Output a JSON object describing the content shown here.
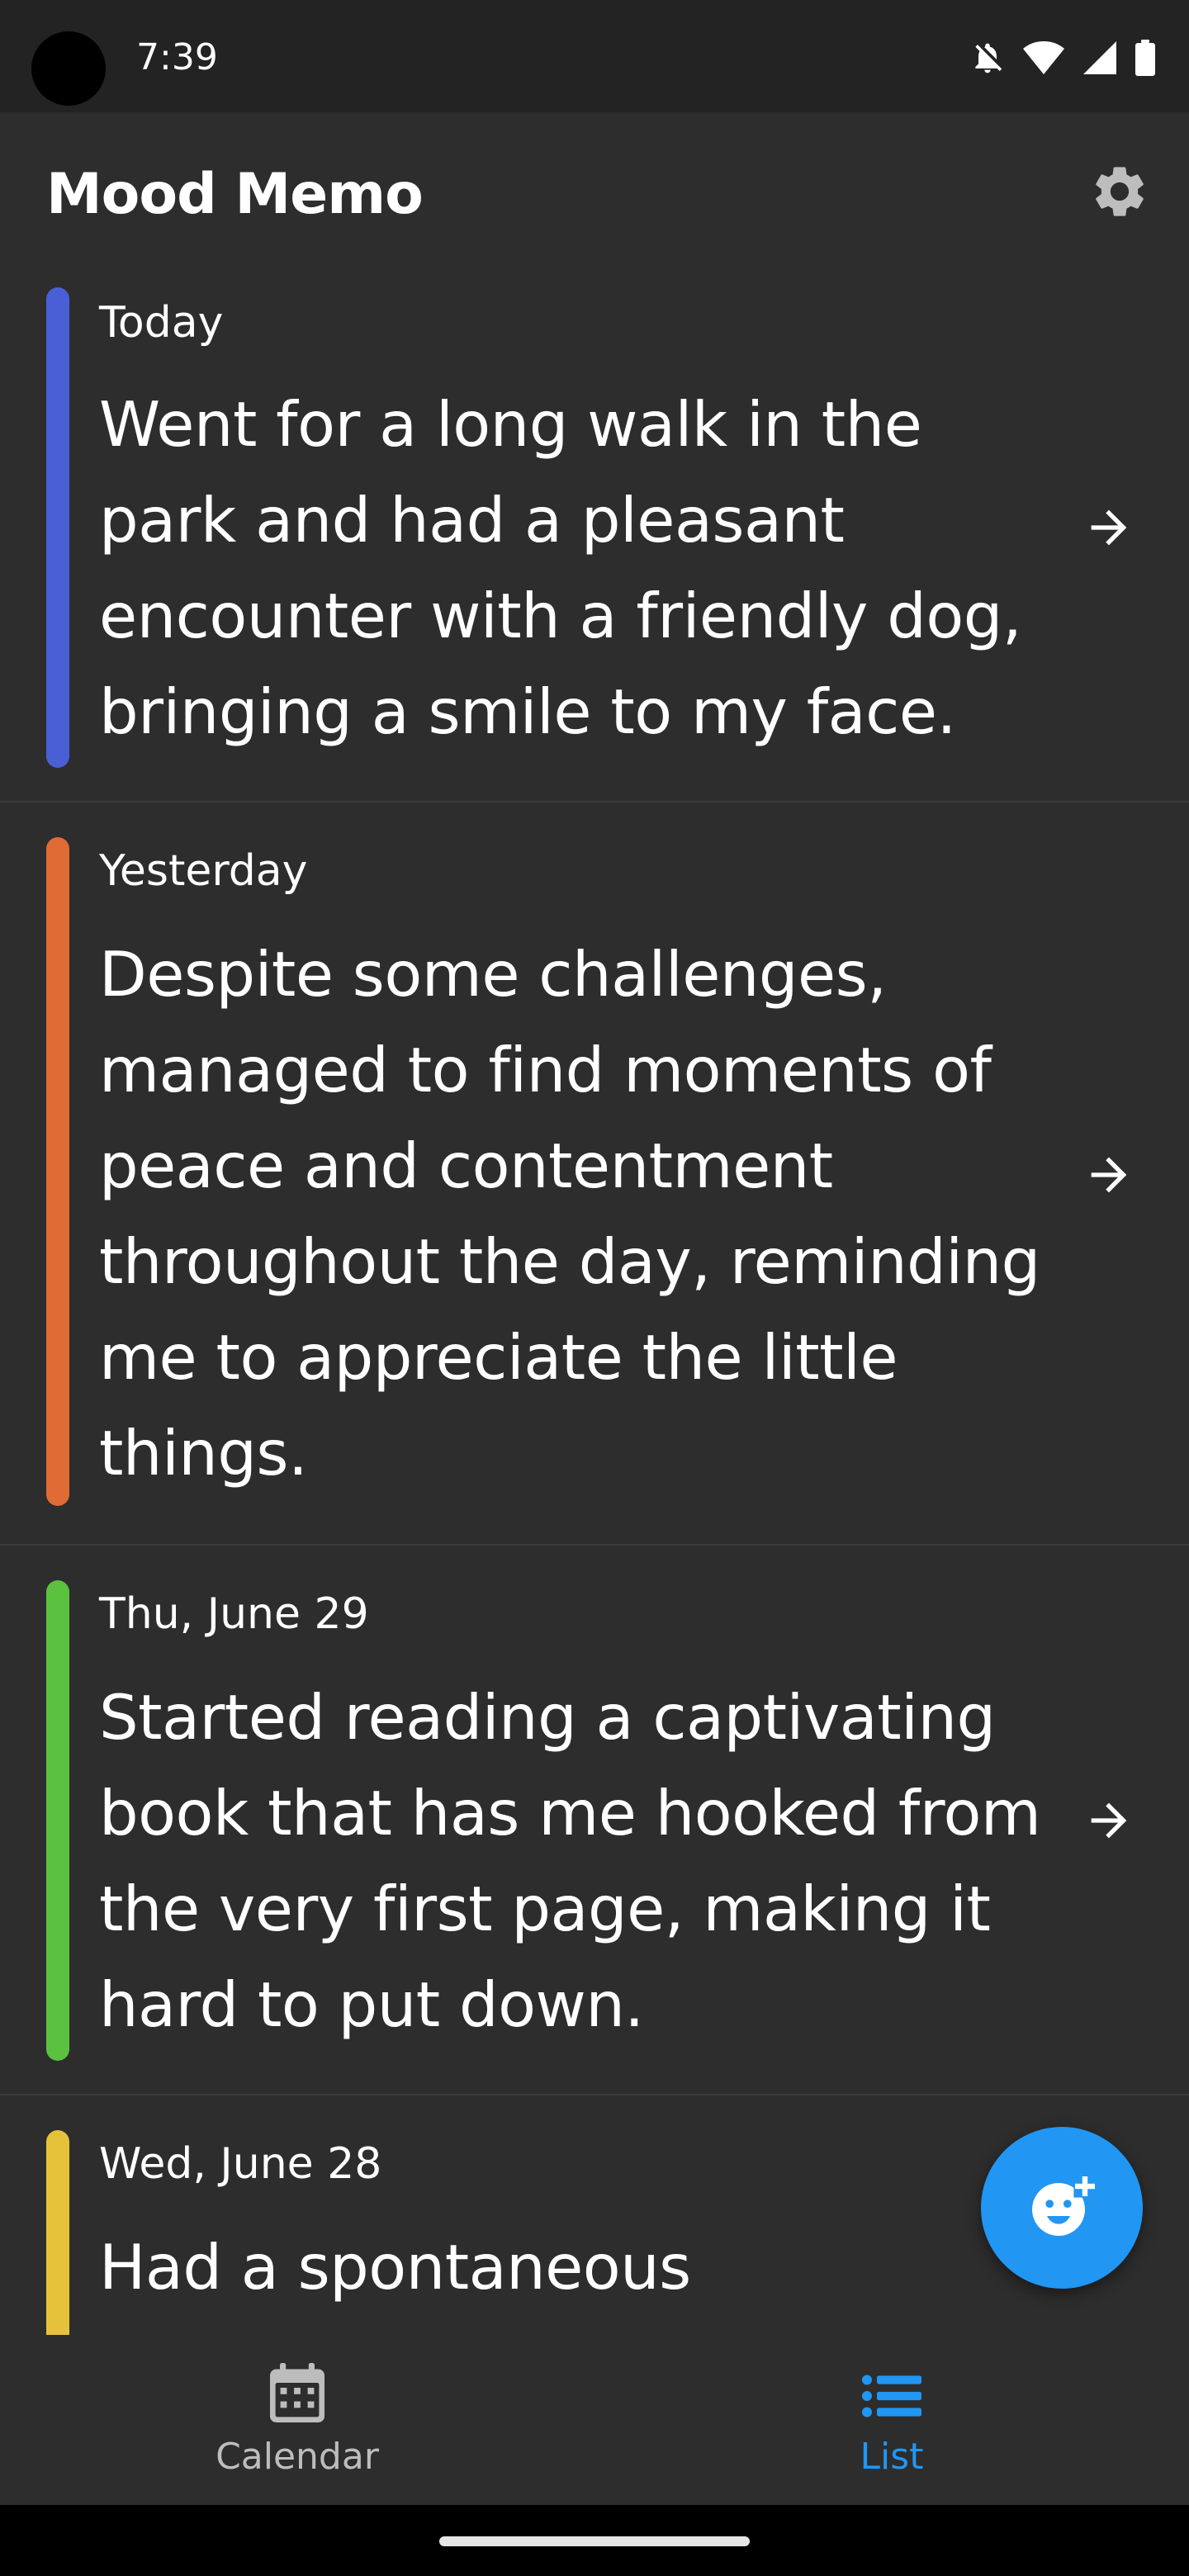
{
  "status_bar": {
    "time": "7:39",
    "icons": [
      "notifications-off-icon",
      "wifi-icon",
      "signal-icon",
      "battery-icon"
    ]
  },
  "app_bar": {
    "title": "Mood Memo",
    "settings_icon": "gear-icon"
  },
  "entries": [
    {
      "date": "Today",
      "text": "Went for a long walk in the park and had a pleasant encounter with a friendly dog, bringing a smile to my face.",
      "mood_color": "#4a5fd6"
    },
    {
      "date": "Yesterday",
      "text": "Despite some challenges, managed to find moments of peace and contentment throughout the day, reminding me to appreciate the little things.",
      "mood_color": "#e06b35"
    },
    {
      "date": "Thu, June 29",
      "text": "Started reading a captivating book that has me hooked from the very first page, making it hard to put down.",
      "mood_color": "#5ac23f"
    },
    {
      "date": "Wed, June 28",
      "text": "Had a spontaneous",
      "mood_color": "#e6c23a"
    }
  ],
  "fab": {
    "icon": "add-mood-icon",
    "color": "#2196f3"
  },
  "bottom_nav": {
    "items": [
      {
        "label": "Calendar",
        "icon": "calendar-icon",
        "active": false
      },
      {
        "label": "List",
        "icon": "list-icon",
        "active": true
      }
    ],
    "active_color": "#2196f3"
  }
}
